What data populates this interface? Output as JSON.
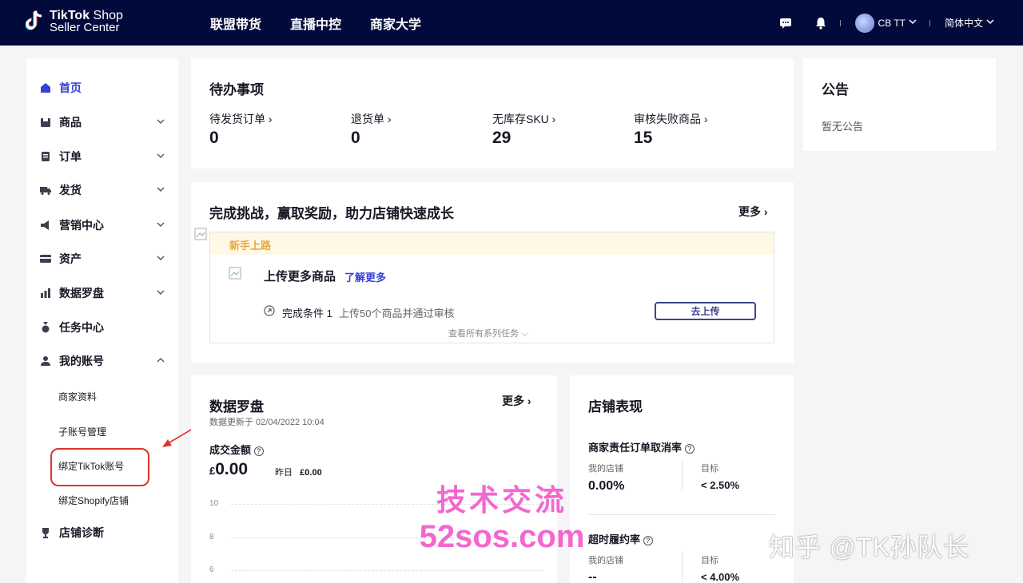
{
  "header": {
    "logo_line1_bold": "TikTok",
    "logo_line1_rest": " Shop",
    "logo_line2": "Seller Center",
    "nav": [
      "联盟带货",
      "直播中控",
      "商家大学"
    ],
    "user_name": "CB TT",
    "language": "简体中文"
  },
  "sidebar": {
    "items": [
      {
        "label": "首页",
        "icon": "home-icon"
      },
      {
        "label": "商品",
        "icon": "product-icon"
      },
      {
        "label": "订单",
        "icon": "order-icon"
      },
      {
        "label": "发货",
        "icon": "truck-icon"
      },
      {
        "label": "营销中心",
        "icon": "megaphone-icon"
      },
      {
        "label": "资产",
        "icon": "card-icon"
      },
      {
        "label": "数据罗盘",
        "icon": "chart-icon"
      },
      {
        "label": "任务中心",
        "icon": "medal-icon"
      },
      {
        "label": "我的账号",
        "icon": "user-icon"
      },
      {
        "label": "店铺诊断",
        "icon": "trophy-icon"
      }
    ],
    "sub_items": [
      "商家资料",
      "子账号管理",
      "绑定TikTok账号",
      "绑定Shopify店铺"
    ]
  },
  "todo": {
    "title": "待办事项",
    "stats": [
      {
        "label": "待发货订单",
        "value": "0"
      },
      {
        "label": "退货单",
        "value": "0"
      },
      {
        "label": "无库存SKU",
        "value": "29"
      },
      {
        "label": "审核失败商品",
        "value": "15"
      }
    ]
  },
  "announce": {
    "title": "公告",
    "empty": "暂无公告"
  },
  "challenge": {
    "title": "完成挑战，赢取奖励，助力店铺快速成长",
    "more": "更多",
    "section": "新手上路",
    "task_title": "上传更多商品",
    "learn_more": "了解更多",
    "condition_label": "完成条件 1",
    "condition_text": "上传50个商品并通过审核",
    "button": "去上传",
    "view_all": "查看所有系列任务"
  },
  "compass": {
    "title": "数据罗盘",
    "more": "更多",
    "updated": "数据更新于 02/04/2022 10:04",
    "metric_label": "成交金额",
    "currency": "£",
    "value": "0.00",
    "yesterday_label": "昨日",
    "yesterday_value": "£0.00",
    "axis": [
      "10",
      "8",
      "6"
    ]
  },
  "performance": {
    "title": "店铺表现",
    "metric1": {
      "label": "商家责任订单取消率",
      "mine_label": "我的店铺",
      "mine": "0.00%",
      "target_label": "目标",
      "target": "< 2.50%"
    },
    "metric2": {
      "label": "超时履约率",
      "mine_label": "我的店铺",
      "mine": "--",
      "target_label": "目标",
      "target": "< 4.00%"
    }
  },
  "watermark": {
    "line1": "技术交流",
    "line2": "52sos.com",
    "zhihu": "知乎 @TK孙队长"
  }
}
